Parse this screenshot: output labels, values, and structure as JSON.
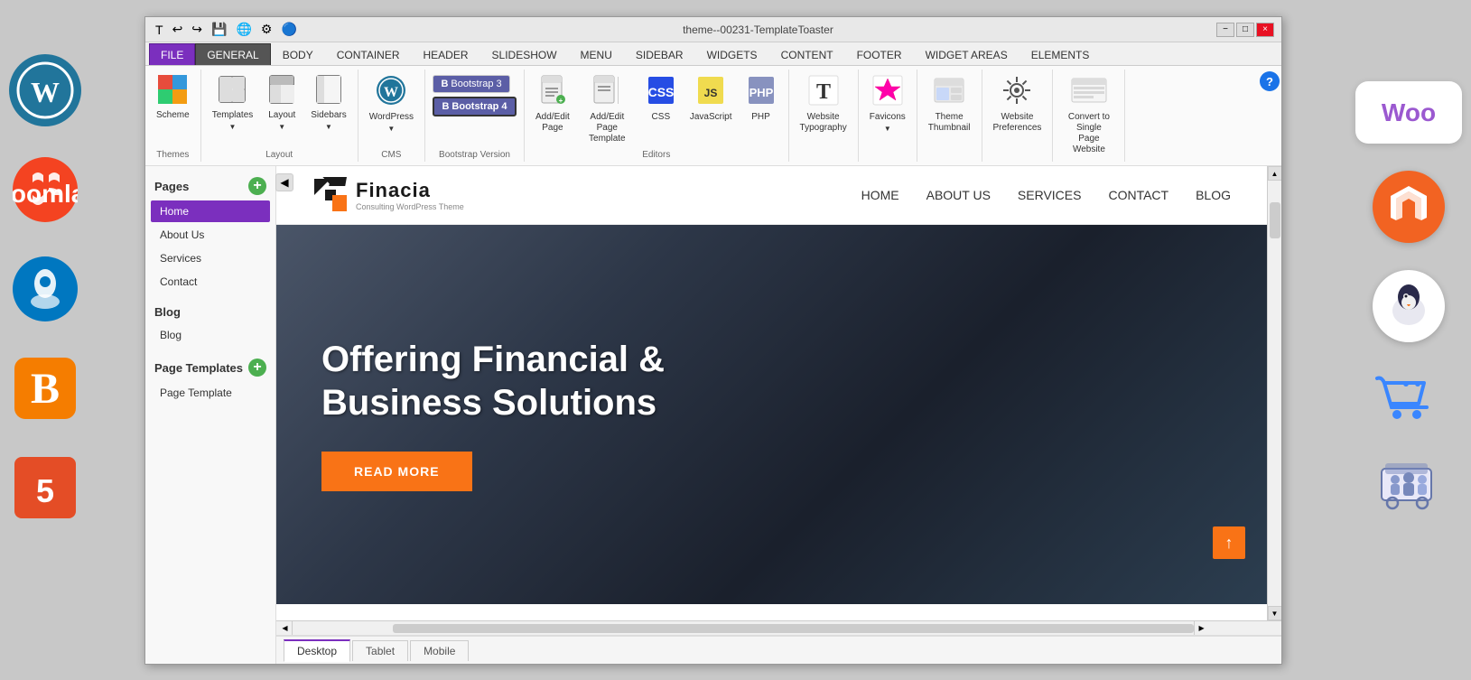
{
  "window": {
    "title": "theme--00231-TemplateToaster",
    "minimize": "−",
    "maximize": "□",
    "close": "×"
  },
  "ribbon": {
    "tabs": [
      {
        "id": "file",
        "label": "FILE",
        "active": true,
        "style": "file"
      },
      {
        "id": "general",
        "label": "GENERAL",
        "active": false,
        "style": "general"
      },
      {
        "id": "body",
        "label": "BODY",
        "active": false,
        "style": "normal"
      },
      {
        "id": "container",
        "label": "CONTAINER",
        "active": false,
        "style": "normal"
      },
      {
        "id": "header",
        "label": "HEADER",
        "active": false,
        "style": "normal"
      },
      {
        "id": "slideshow",
        "label": "SLIDESHOW",
        "active": false,
        "style": "normal"
      },
      {
        "id": "menu",
        "label": "MENU",
        "active": false,
        "style": "normal"
      },
      {
        "id": "sidebar",
        "label": "SIDEBAR",
        "active": false,
        "style": "normal"
      },
      {
        "id": "widgets",
        "label": "WIDGETS",
        "active": false,
        "style": "normal"
      },
      {
        "id": "content",
        "label": "CONTENT",
        "active": false,
        "style": "normal"
      },
      {
        "id": "footer",
        "label": "FOOTER",
        "active": false,
        "style": "normal"
      },
      {
        "id": "widget-areas",
        "label": "WIDGET AREAS",
        "active": false,
        "style": "normal"
      },
      {
        "id": "elements",
        "label": "ELEMENTS",
        "active": false,
        "style": "normal"
      }
    ],
    "groups": {
      "themes": {
        "label": "Themes",
        "items": [
          {
            "id": "scheme",
            "label": "Scheme",
            "icon": "🎨"
          }
        ]
      },
      "layout_group": {
        "label": "Layout",
        "items": [
          {
            "id": "templates",
            "label": "Templates",
            "icon": "📋"
          },
          {
            "id": "layout",
            "label": "Layout",
            "icon": "⊞"
          },
          {
            "id": "sidebars",
            "label": "Sidebars",
            "icon": "▦"
          }
        ]
      },
      "cms": {
        "label": "CMS",
        "items": [
          {
            "id": "wordpress",
            "label": "WordPress",
            "icon": "🔵"
          }
        ]
      },
      "bootstrap": {
        "label": "Bootstrap Version",
        "items": [
          {
            "id": "bootstrap3",
            "label": "Bootstrap 3"
          },
          {
            "id": "bootstrap4",
            "label": "Bootstrap 4"
          }
        ]
      },
      "editors": {
        "label": "Editors",
        "items": [
          {
            "id": "add-edit-page",
            "label": "Add/Edit Page",
            "icon": "📄"
          },
          {
            "id": "add-edit-page-template",
            "label": "Add/Edit Page Template",
            "icon": "📄"
          },
          {
            "id": "css",
            "label": "CSS",
            "icon": "🎯"
          },
          {
            "id": "javascript",
            "label": "JavaScript",
            "icon": "📜"
          },
          {
            "id": "php",
            "label": "PHP",
            "icon": "🐘"
          }
        ]
      },
      "typography": {
        "items": [
          {
            "id": "website-typography",
            "label": "Website Typography",
            "icon": "T"
          }
        ]
      },
      "favicons": {
        "items": [
          {
            "id": "favicons",
            "label": "Favicons",
            "icon": "⭐"
          }
        ]
      },
      "theme_thumbnail": {
        "items": [
          {
            "id": "theme-thumbnail",
            "label": "Theme Thumbnail",
            "icon": "🖼"
          }
        ]
      },
      "website_prefs": {
        "items": [
          {
            "id": "website-preferences",
            "label": "Website Preferences",
            "icon": "⚙"
          }
        ]
      },
      "convert": {
        "items": [
          {
            "id": "convert-single",
            "label": "Convert to Single Page Website",
            "icon": "📰"
          }
        ]
      }
    }
  },
  "left_panel": {
    "pages_section": {
      "title": "Pages",
      "items": [
        {
          "id": "home",
          "label": "Home",
          "active": true
        },
        {
          "id": "about",
          "label": "About Us",
          "active": false
        },
        {
          "id": "services",
          "label": "Services",
          "active": false
        },
        {
          "id": "contact",
          "label": "Contact",
          "active": false
        }
      ]
    },
    "blog_section": {
      "title": "Blog",
      "items": [
        {
          "id": "blog",
          "label": "Blog",
          "active": false
        }
      ]
    },
    "page_templates_section": {
      "title": "Page Templates",
      "items": [
        {
          "id": "page-template",
          "label": "Page Template",
          "active": false
        }
      ]
    }
  },
  "website_preview": {
    "logo_text": "Finacia",
    "logo_subtitle": "Consulting WordPress Theme",
    "nav_links": [
      "HOME",
      "ABOUT US",
      "SERVICES",
      "CONTACT",
      "BLOG"
    ],
    "hero": {
      "title_line1": "Offering Financial &",
      "title_line2": "Business Solutions",
      "cta_button": "READ MORE"
    }
  },
  "view_tabs": [
    {
      "id": "desktop",
      "label": "Desktop",
      "active": true
    },
    {
      "id": "tablet",
      "label": "Tablet",
      "active": false
    },
    {
      "id": "mobile",
      "label": "Mobile",
      "active": false
    }
  ],
  "side_icons": {
    "left": [
      {
        "id": "wordpress",
        "label": "WordPress",
        "color": "#21759b",
        "symbol": "W"
      },
      {
        "id": "joomla",
        "label": "Joomla",
        "color": "#f44321",
        "symbol": "J"
      },
      {
        "id": "drupal",
        "label": "Drupal",
        "color": "#0077c0",
        "symbol": "D"
      },
      {
        "id": "blogger",
        "label": "Blogger",
        "color": "#f57d00",
        "symbol": "B"
      },
      {
        "id": "html5",
        "label": "HTML5",
        "color": "#e44d26",
        "symbol": "5"
      }
    ],
    "right": [
      {
        "id": "woocommerce",
        "label": "WooCommerce",
        "symbol": "Woo",
        "bg": "#9b59d0"
      },
      {
        "id": "magento",
        "label": "Magento",
        "color": "#f26322",
        "symbol": "M"
      },
      {
        "id": "opencart",
        "label": "OpenCart",
        "color": "#1e90ff",
        "symbol": "🛒"
      },
      {
        "id": "ecwid",
        "label": "Ecwid",
        "color": "#ff6b35",
        "symbol": "🛍"
      },
      {
        "id": "cart",
        "label": "Cart",
        "color": "#3a86ff",
        "symbol": "🛒"
      }
    ]
  },
  "colors": {
    "accent_purple": "#7b2fbe",
    "accent_orange": "#f97316",
    "toolbar_bg": "#fafafa",
    "panel_bg": "#f8f8f8",
    "active_item_bg": "#7b2fbe",
    "hero_btn": "#f97316"
  }
}
